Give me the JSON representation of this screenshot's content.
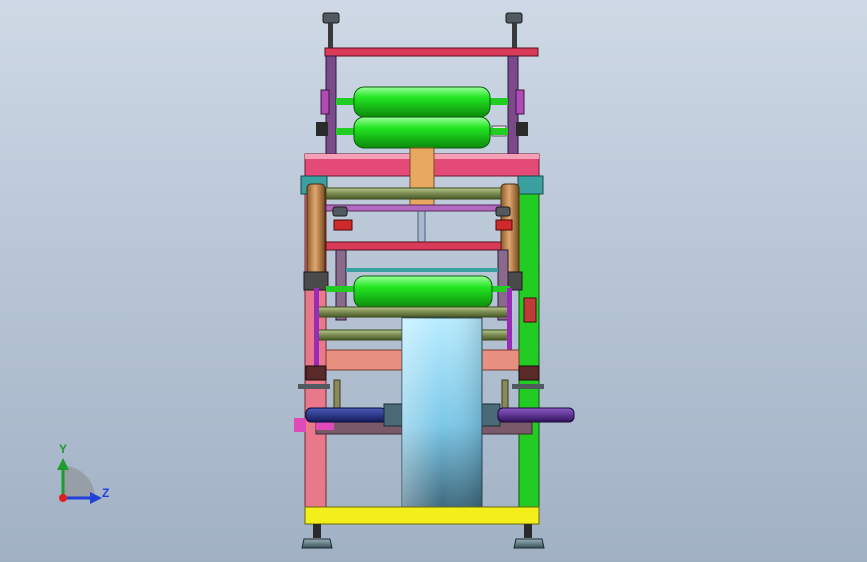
{
  "viewport": {
    "background_top": "#cfd9e6",
    "background_bottom": "#a1b1c4"
  },
  "triad": {
    "y_label": "Y",
    "z_label": "Z",
    "y_color": "#1f9c2d",
    "z_color": "#2040d8",
    "x_color": "#e02020"
  },
  "model": {
    "roller_color": "#22e622",
    "frame_green": "#22cc22",
    "frame_pink": "#e8788a",
    "top_bar_color": "#d83a58",
    "base_color": "#f2ef1a",
    "film_light": "#cdeeff",
    "film_dark": "#4a7890",
    "shaft_blue": "#2a3a8a",
    "shaft_purple": "#5a2a8a",
    "cylinder_tan": "#c89058"
  }
}
